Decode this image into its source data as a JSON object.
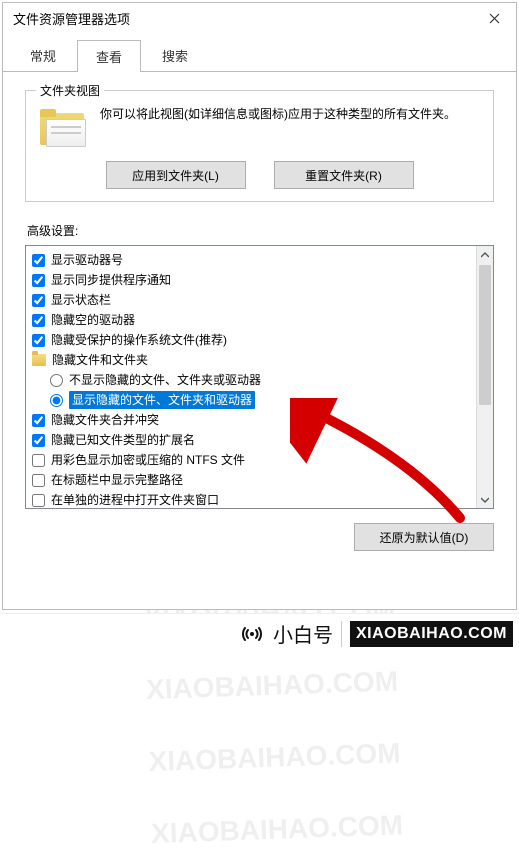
{
  "window": {
    "title": "文件资源管理器选项"
  },
  "tabs": {
    "general": "常规",
    "view": "查看",
    "search": "搜索"
  },
  "folderView": {
    "groupLabel": "文件夹视图",
    "desc": "你可以将此视图(如详细信息或图标)应用于这种类型的所有文件夹。",
    "applyBtn": "应用到文件夹(L)",
    "resetBtn": "重置文件夹(R)"
  },
  "advanced": {
    "label": "高级设置:",
    "items": [
      {
        "type": "checkbox",
        "checked": true,
        "label": "显示驱动器号"
      },
      {
        "type": "checkbox",
        "checked": true,
        "label": "显示同步提供程序通知"
      },
      {
        "type": "checkbox",
        "checked": true,
        "label": "显示状态栏"
      },
      {
        "type": "checkbox",
        "checked": true,
        "label": "隐藏空的驱动器"
      },
      {
        "type": "checkbox",
        "checked": true,
        "label": "隐藏受保护的操作系统文件(推荐)"
      },
      {
        "type": "folder",
        "label": "隐藏文件和文件夹"
      },
      {
        "type": "radio",
        "checked": false,
        "indent": true,
        "label": "不显示隐藏的文件、文件夹或驱动器"
      },
      {
        "type": "radio",
        "checked": true,
        "indent": true,
        "selected": true,
        "label": "显示隐藏的文件、文件夹和驱动器"
      },
      {
        "type": "checkbox",
        "checked": true,
        "label": "隐藏文件夹合并冲突"
      },
      {
        "type": "checkbox",
        "checked": true,
        "label": "隐藏已知文件类型的扩展名"
      },
      {
        "type": "checkbox",
        "checked": false,
        "label": "用彩色显示加密或压缩的 NTFS 文件"
      },
      {
        "type": "checkbox",
        "checked": false,
        "label": "在标题栏中显示完整路径"
      },
      {
        "type": "checkbox",
        "checked": false,
        "label": "在单独的进程中打开文件夹窗口"
      }
    ],
    "restoreBtn": "还原为默认值(D)"
  },
  "watermark": "XIAOBAIHAO.COM",
  "brand": {
    "cn": "小白号",
    "en": "XIAOBAIHAO.COM"
  }
}
